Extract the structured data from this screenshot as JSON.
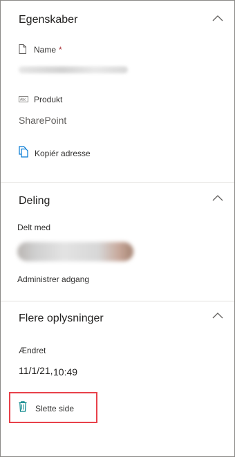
{
  "properties": {
    "title": "Egenskaber",
    "name_label": "Name",
    "name_required_marker": "*",
    "product_label": "Produkt",
    "product_value": "SharePoint",
    "copy_address_label": "Kopiér adresse"
  },
  "sharing": {
    "title": "Deling",
    "shared_with_label": "Delt med",
    "manage_access_label": "Administrer adgang"
  },
  "more_info": {
    "title": "Flere oplysninger",
    "modified_label": "Ændret",
    "modified_date": "11/1/21,",
    "modified_time": "10:49"
  },
  "actions": {
    "delete_page_label": "Slette side"
  },
  "colors": {
    "accent": "#0078d4",
    "highlight": "#e8414a"
  }
}
